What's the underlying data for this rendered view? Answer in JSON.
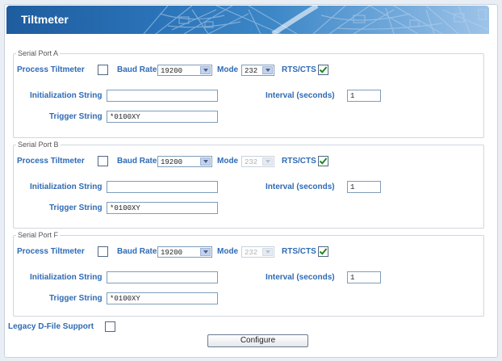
{
  "header": {
    "title": "Tiltmeter"
  },
  "labels": {
    "process_tiltmeter": "Process Tiltmeter",
    "baud_rate": "Baud Rate",
    "mode": "Mode",
    "rts_cts": "RTS/CTS",
    "initialization_string": "Initialization String",
    "interval_seconds": "Interval (seconds)",
    "trigger_string": "Trigger String"
  },
  "ports": [
    {
      "legend": "Serial Port A",
      "process_tiltmeter": false,
      "baud_rate": "19200",
      "mode": "232",
      "mode_enabled": true,
      "rts_cts": true,
      "init_string": "",
      "interval": "1",
      "trigger_string": "*0100XY"
    },
    {
      "legend": "Serial Port B",
      "process_tiltmeter": false,
      "baud_rate": "19200",
      "mode": "232",
      "mode_enabled": false,
      "rts_cts": true,
      "init_string": "",
      "interval": "1",
      "trigger_string": "*0100XY"
    },
    {
      "legend": "Serial Port F",
      "process_tiltmeter": false,
      "baud_rate": "19200",
      "mode": "232",
      "mode_enabled": false,
      "rts_cts": true,
      "init_string": "",
      "interval": "1",
      "trigger_string": "*0100XY"
    }
  ],
  "legacy": {
    "label": "Legacy D-File Support",
    "checked": false
  },
  "configure_button": {
    "label": "Configure"
  },
  "colors": {
    "banner": "#2a72b7",
    "label_blue": "#2e6ab4",
    "check_green": "#1c8a1c"
  }
}
